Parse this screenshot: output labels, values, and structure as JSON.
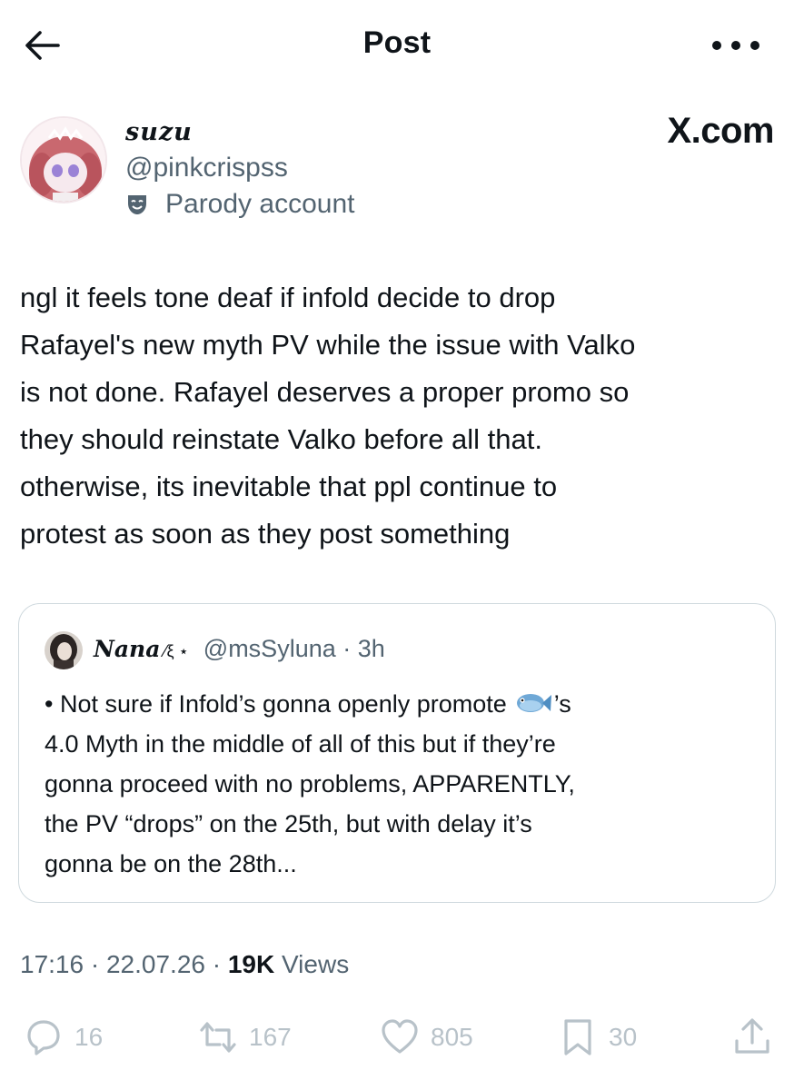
{
  "header": {
    "title": "Post",
    "back_icon": "arrow-left-icon",
    "more_icon": "more-dots-icon"
  },
  "author": {
    "display_name": "suzu",
    "handle": "@pinkcrispss",
    "label": "Parody account",
    "label_icon": "parody-mask-icon"
  },
  "brand": "X.com",
  "post": {
    "lines": [
      "ngl it feels tone deaf if infold decide to drop",
      "Rafayel's new myth PV while the issue with Valko",
      "is not done. Rafayel deserves a proper promo so",
      "they should reinstate Valko before all that.",
      "otherwise, its inevitable that ppl continue to",
      "protest as soon as they post something"
    ]
  },
  "quote": {
    "name": "Nana",
    "name_deco": "⁄ξ ⋆",
    "handle_time": "@msSyluna · 3h",
    "line1_before": "• Not sure if Infold’s gonna openly promote",
    "line1_after": "’s",
    "fish_icon": "fish-emoji-icon",
    "lines": [
      "4.0 Myth in the middle of all of this but if they’re",
      "gonna proceed with no problems, APPARENTLY,",
      "the PV “drops” on the 25th, but with delay it’s",
      "gonna be on the 28th..."
    ]
  },
  "meta": {
    "time": "17:16",
    "date": "22.07.26",
    "views_count": "19K",
    "views_label": "Views",
    "separator": "·"
  },
  "actions": {
    "replies": "16",
    "reposts": "167",
    "likes": "805",
    "bookmarks": "30"
  },
  "colors": {
    "text": "#0f1419",
    "secondary": "#536471",
    "border": "#cfd9de",
    "action_gray": "#b8c2c9"
  }
}
